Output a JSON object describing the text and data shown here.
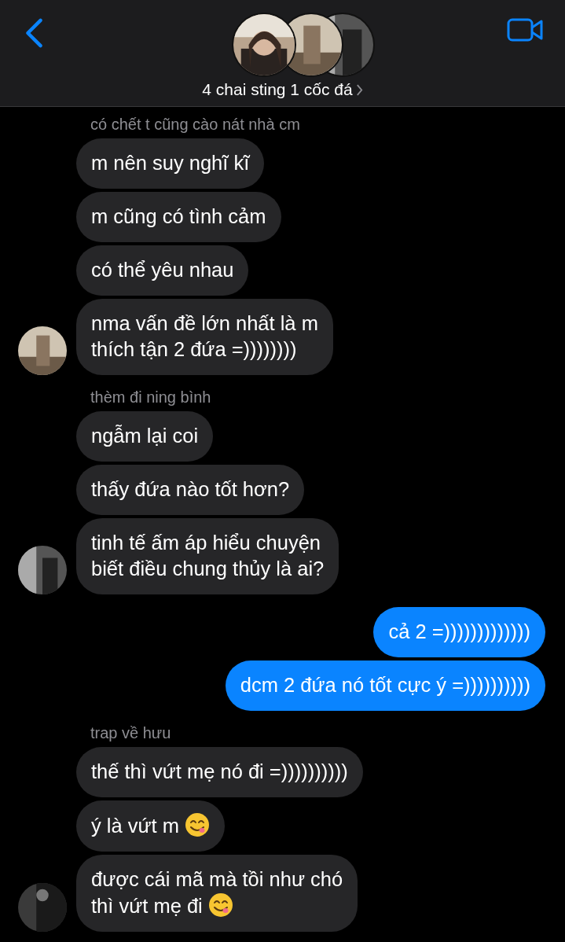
{
  "header": {
    "title": "4 chai sting 1 cốc đá"
  },
  "messages": [
    {
      "kind": "received",
      "sender": "có chết t cũng cào nát nhà cm",
      "bubbles": [
        {
          "lines": [
            "m nên suy nghĩ kĩ"
          ]
        },
        {
          "lines": [
            "m cũng có tình cảm"
          ]
        },
        {
          "lines": [
            "có thể yêu nhau"
          ]
        },
        {
          "lines": [
            "nma vấn đề lớn nhất là m",
            "thích tận 2 đứa =))))))))"
          ]
        }
      ]
    },
    {
      "kind": "received",
      "sender": "thèm đi ning bình",
      "bubbles": [
        {
          "lines": [
            "ngẫm lại coi"
          ]
        },
        {
          "lines": [
            "thấy đứa nào tốt hơn?"
          ]
        },
        {
          "lines": [
            "tinh tế ấm áp hiểu chuyện",
            "biết điều chung thủy là ai?"
          ]
        }
      ]
    },
    {
      "kind": "sent",
      "bubbles": [
        {
          "lines": [
            "cả 2 =)))))))))))))"
          ]
        },
        {
          "lines": [
            "dcm 2 đứa nó tốt cực ý =))))))))))"
          ]
        }
      ]
    },
    {
      "kind": "received",
      "sender": "trap về hưu",
      "bubbles": [
        {
          "lines": [
            "thế thì vứt mẹ nó đi =))))))))))"
          ]
        },
        {
          "lines": [
            "ý là vứt m"
          ],
          "emoji": true
        },
        {
          "lines": [
            "được cái mã mà tồi như chó",
            "thì vứt mẹ đi"
          ],
          "emoji": true
        }
      ]
    }
  ]
}
